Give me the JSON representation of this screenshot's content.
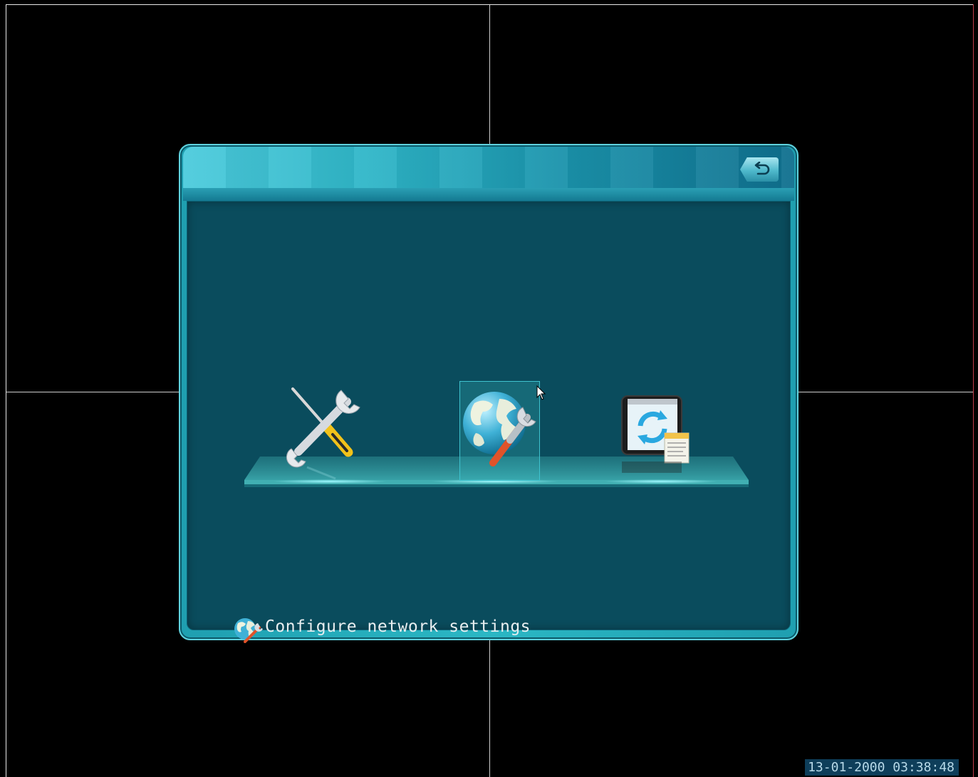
{
  "dialog": {
    "back_button": {
      "icon": "back-arrow-icon"
    },
    "menu_items": [
      {
        "id": "general",
        "icon": "tools-icon",
        "selected": false
      },
      {
        "id": "network",
        "icon": "network-globe-wrench-icon",
        "selected": true
      },
      {
        "id": "upgrade",
        "icon": "system-upgrade-icon",
        "selected": false
      }
    ],
    "status_text": "Configure network settings",
    "status_icon": "network-globe-wrench-icon"
  },
  "clock": {
    "text": "13-01-2000 03:38:48"
  },
  "colors": {
    "background": "#000000",
    "dialog_accent": "#2bb7c4",
    "content_bg": "#0a4c5d",
    "clock_bg": "#0e3e5a"
  }
}
